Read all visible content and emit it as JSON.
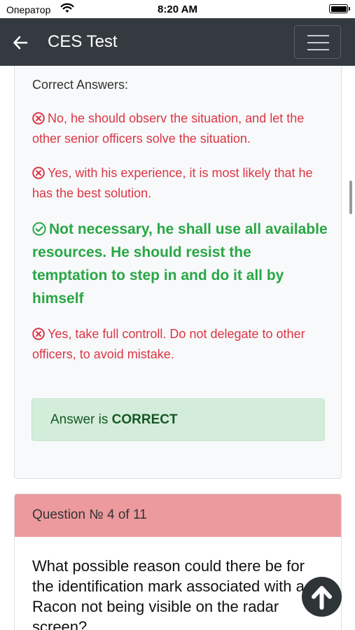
{
  "status": {
    "carrier": "Оператор",
    "time": "8:20 AM"
  },
  "navbar": {
    "title": "CES Test",
    "back_icon": "arrow-left-icon",
    "menu_icon": "hamburger-icon"
  },
  "answers_card": {
    "heading": "Correct Answers:",
    "options": [
      {
        "text": "No, he should observ the situation, and let the other senior officers solve the situation.",
        "status": "wrong",
        "icon": "x-circle-icon"
      },
      {
        "text": "Yes, with his experience, it is most likely that he has the best solution.",
        "status": "wrong",
        "icon": "x-circle-icon"
      },
      {
        "text": "Not necessary, he shall use all available resources. He should resist the temptation to step in and do it all by himself",
        "status": "correct",
        "icon": "check-circle-icon"
      },
      {
        "text": "Yes, take full controll. Do not delegate to other officers, to avoid mistake.",
        "status": "wrong",
        "icon": "x-circle-icon"
      }
    ],
    "result_prefix": "Answer is ",
    "result_value": "CORRECT"
  },
  "question_card": {
    "header": "Question № 4 of 11",
    "question": "What possible reason could there be for the identification mark associated with a Racon not being visible on the radar screen?"
  },
  "colors": {
    "navbar": "#343a40",
    "wrong": "#dc3545",
    "correct": "#28a745",
    "result_bg": "#d4edda",
    "question_header_bg": "#ec9a9d"
  },
  "scroll_top_icon": "arrow-up-circle-icon"
}
